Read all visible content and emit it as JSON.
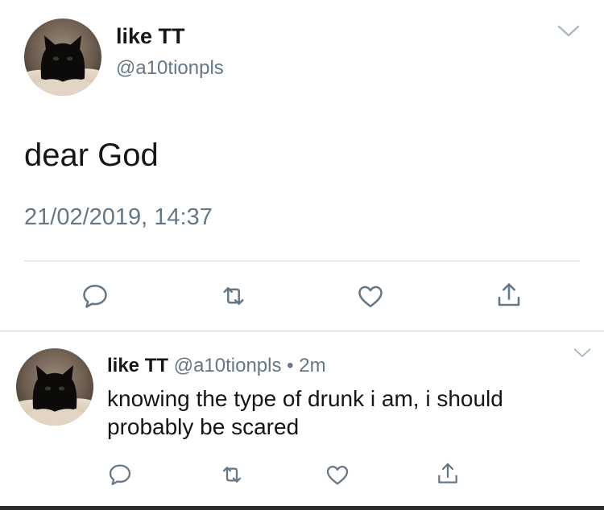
{
  "main_tweet": {
    "display_name": "like TT",
    "handle": "@a10tionpls",
    "text": "dear God",
    "timestamp": "21/02/2019, 14:37",
    "actions": [
      "reply-icon",
      "retweet-icon",
      "like-icon",
      "share-icon"
    ]
  },
  "reply_tweet": {
    "display_name": "like TT",
    "handle": "@a10tionpls",
    "separator": "•",
    "time_ago": "2m",
    "text": "knowing the type of drunk i am, i should probably be scared",
    "actions": [
      "reply-icon",
      "retweet-icon",
      "like-icon",
      "share-icon"
    ]
  },
  "colors": {
    "text": "#14171a",
    "secondary": "#657786",
    "icon": "#657786",
    "divider": "#d8d8d8"
  }
}
